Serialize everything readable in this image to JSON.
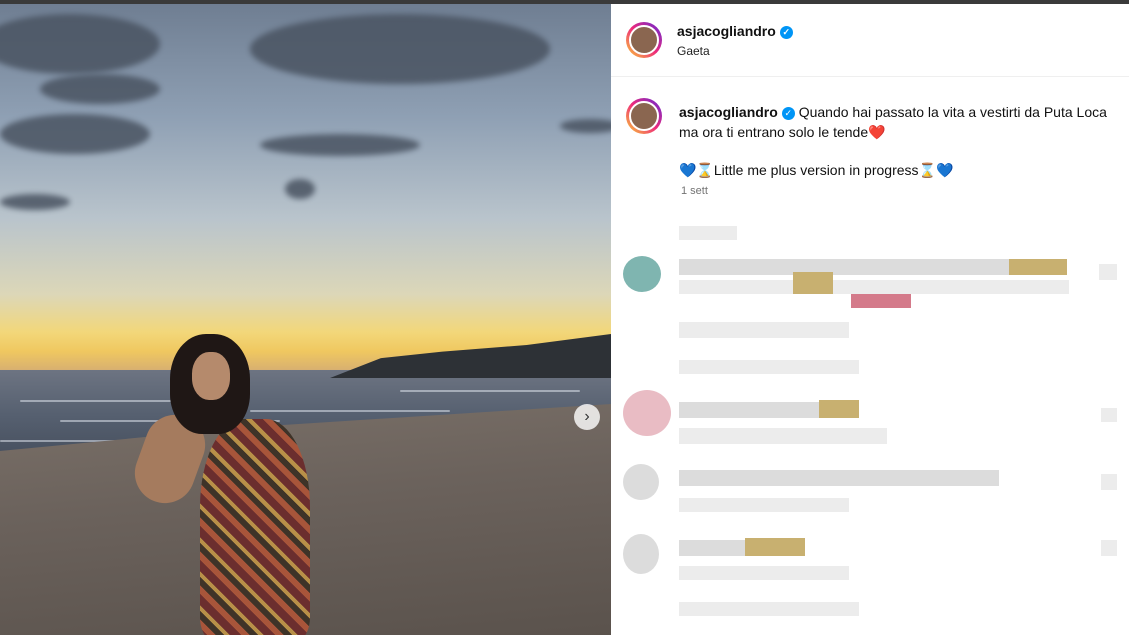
{
  "post": {
    "username": "asjacogliandro",
    "location": "Gaeta",
    "caption_line1": "Quando hai passato la vita a vestirti da Puta Loca",
    "caption_line2": "ma ora ti entrano solo le tende",
    "caption_line2_emoji": "❤️",
    "caption_line3_prefix": "💙⌛",
    "caption_line3_text": "Little me plus version in progress",
    "caption_line3_suffix": "⌛💙",
    "time": "1 sett"
  },
  "icons": {
    "verified": "verified-badge-icon",
    "next": "chevron-right-icon"
  },
  "colors": {
    "verified": "#0095f6",
    "text": "#111111",
    "muted": "#737373"
  }
}
